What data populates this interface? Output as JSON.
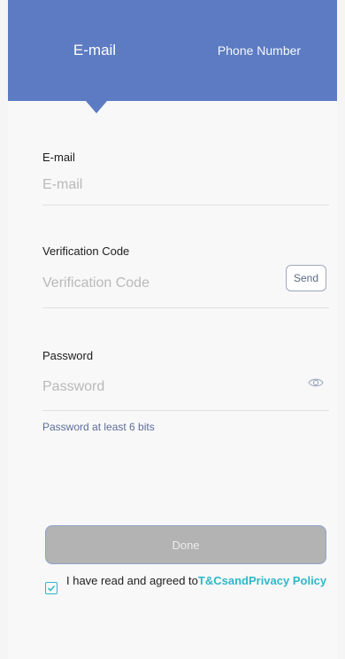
{
  "tabs": {
    "email": "E-mail",
    "phone": "Phone Number"
  },
  "fields": {
    "email": {
      "label": "E-mail",
      "value": "",
      "placeholder": "E-mail"
    },
    "verification": {
      "label": "Verification Code",
      "value": "",
      "placeholder": "Verification Code",
      "send_label": "Send"
    },
    "password": {
      "label": "Password",
      "value": "",
      "placeholder": "Password",
      "hint": "Password at least 6 bits"
    }
  },
  "done_label": "Done",
  "agreement": {
    "prefix": "I have read and agreed to",
    "terms": "T&Cs",
    "and": "and",
    "privacy": "Privacy Policy",
    "checked": true
  },
  "icons": {
    "password_toggle": "eye-icon",
    "agreement_checkbox": "checkmark-icon"
  },
  "colors": {
    "header": "#5c7bc2",
    "link": "#2fb7c9",
    "button_disabled": "#b3b3b3"
  }
}
